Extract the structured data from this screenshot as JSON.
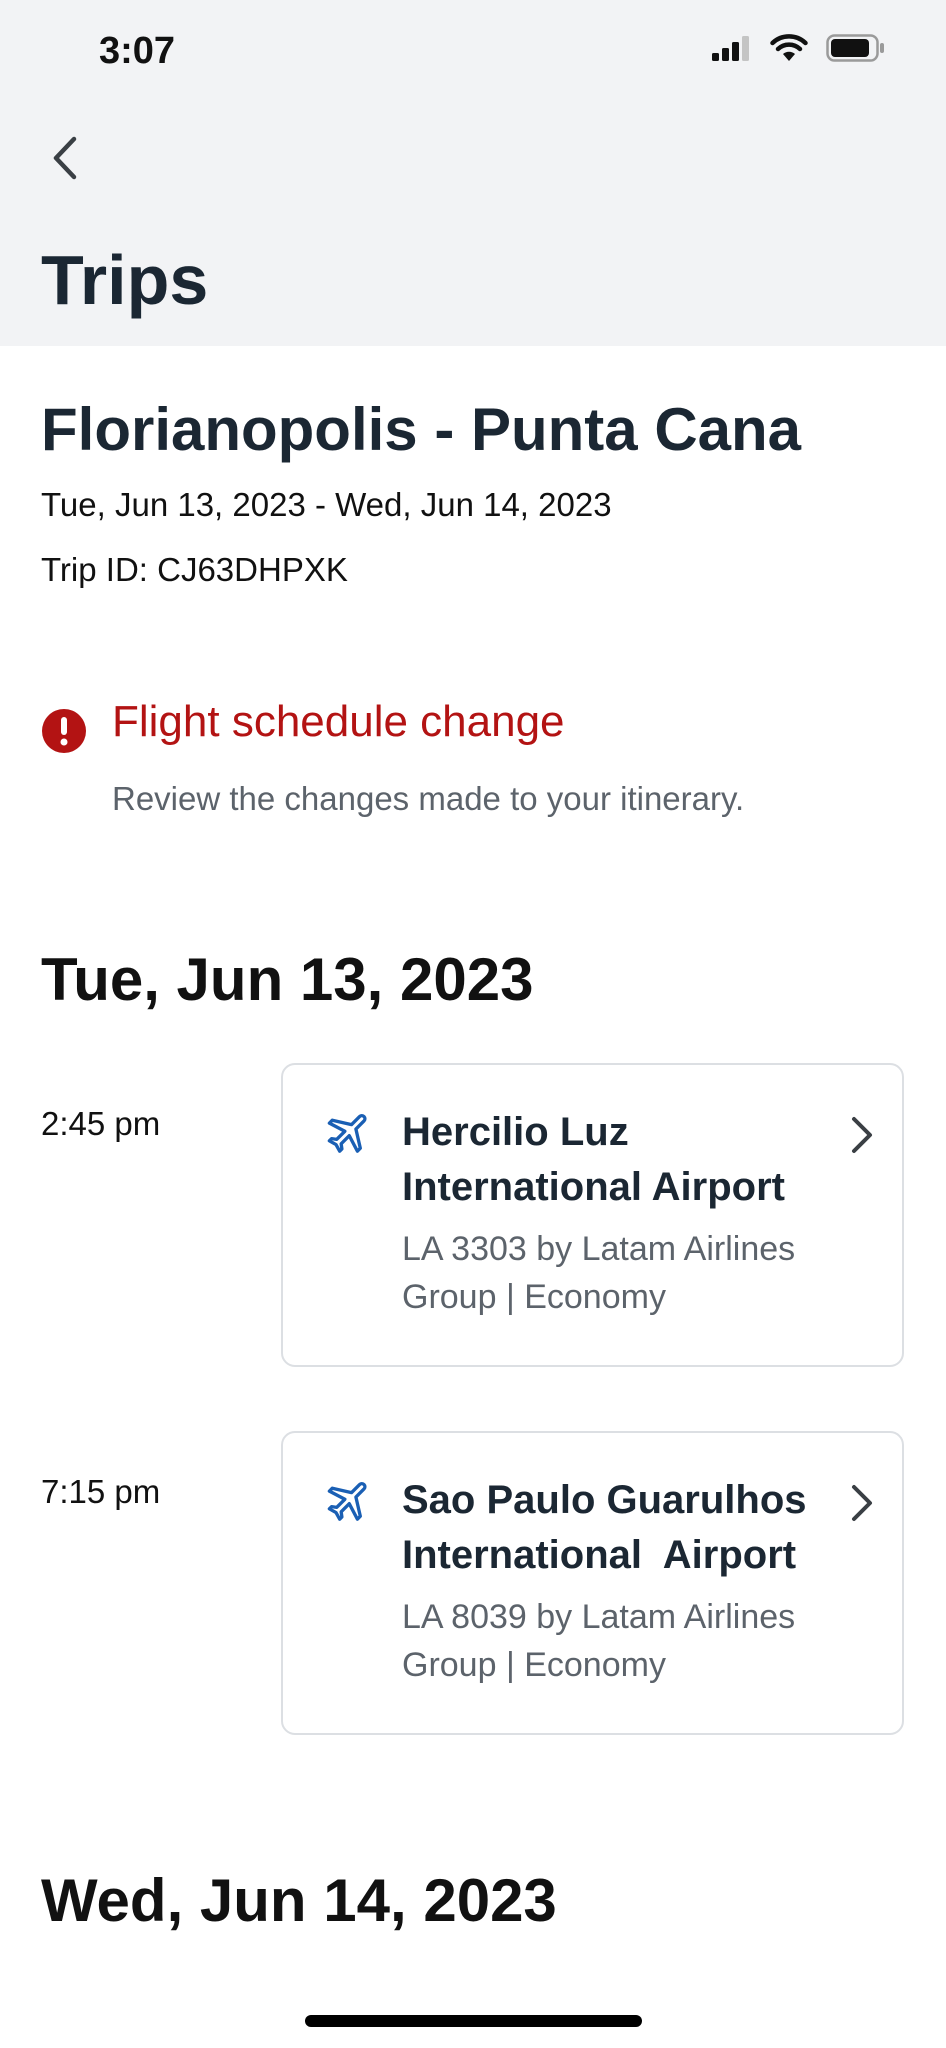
{
  "status_bar": {
    "time": "3:07"
  },
  "header": {
    "title": "Trips"
  },
  "trip": {
    "title": "Florianopolis - Punta Cana",
    "dates": "Tue, Jun 13, 2023 - Wed, Jun 14, 2023",
    "id_label": "Trip ID: CJ63DHPXK"
  },
  "alert": {
    "title": "Flight schedule change",
    "description": "Review the changes made to your itinerary."
  },
  "days": [
    {
      "heading": "Tue, Jun 13, 2023",
      "segments": [
        {
          "time": "2:45 pm",
          "name": "Hercilio Luz\nInternational Airport",
          "details": "LA 3303 by Latam Airlines Group | Economy"
        },
        {
          "time": "7:15 pm",
          "name": "Sao Paulo Guarulhos\nInternational  Airport",
          "details": "LA 8039 by Latam Airlines Group | Economy"
        }
      ]
    },
    {
      "heading": "Wed, Jun 14, 2023",
      "segments": []
    }
  ],
  "colors": {
    "header_bg": "#f2f3f5",
    "alert_red": "#b31313",
    "plane_blue": "#1a5fb4",
    "text_dark": "#1b2733"
  }
}
